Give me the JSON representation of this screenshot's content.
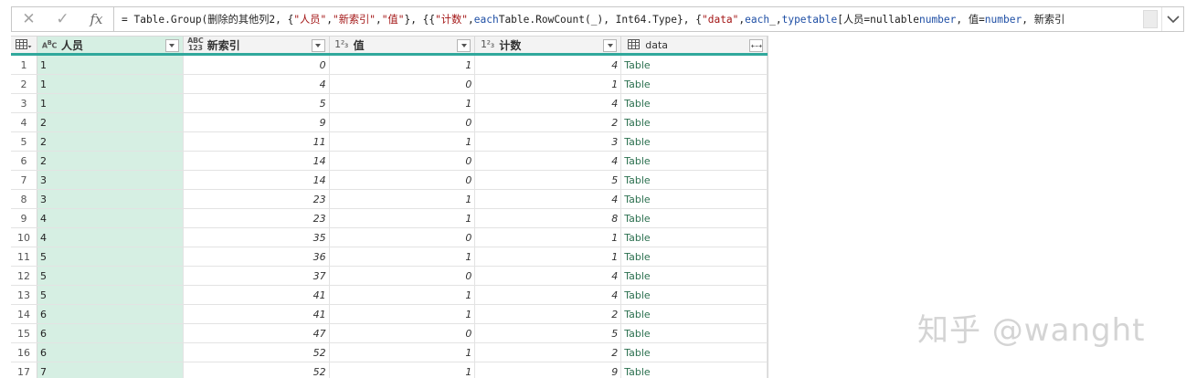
{
  "formula_bar": {
    "cancel_icon": "close-icon",
    "confirm_icon": "check-icon",
    "fx_label": "fx",
    "segments": [
      {
        "t": "= Table.Group(删除的其他列2, {",
        "c": ""
      },
      {
        "t": "\"人员\"",
        "c": "str"
      },
      {
        "t": ", ",
        "c": ""
      },
      {
        "t": "\"新索引\"",
        "c": "str"
      },
      {
        "t": ", ",
        "c": ""
      },
      {
        "t": "\"值\"",
        "c": "str"
      },
      {
        "t": "}, {{",
        "c": ""
      },
      {
        "t": "\"计数\"",
        "c": "str"
      },
      {
        "t": ", ",
        "c": ""
      },
      {
        "t": "each",
        "c": "kw"
      },
      {
        "t": " Table.RowCount(_), Int64.Type}, {",
        "c": ""
      },
      {
        "t": "\"data\"",
        "c": "str"
      },
      {
        "t": ", ",
        "c": ""
      },
      {
        "t": "each",
        "c": "kw"
      },
      {
        "t": " _, ",
        "c": ""
      },
      {
        "t": "type",
        "c": "kw"
      },
      {
        "t": " ",
        "c": ""
      },
      {
        "t": "table",
        "c": "kw"
      },
      {
        "t": " [人员=nullable ",
        "c": ""
      },
      {
        "t": "number",
        "c": "kw"
      },
      {
        "t": ", 值=",
        "c": ""
      },
      {
        "t": "number",
        "c": "kw"
      },
      {
        "t": ", 新索引",
        "c": ""
      }
    ]
  },
  "table": {
    "columns": [
      {
        "name": "人员",
        "type_icon": "ABC"
      },
      {
        "name": "新索引",
        "type_icon": "ABC123"
      },
      {
        "name": "值",
        "type_icon": "123"
      },
      {
        "name": "计数",
        "type_icon": "123"
      },
      {
        "name": "data",
        "type_icon": "table"
      }
    ],
    "rows": [
      [
        "1",
        "1",
        "0",
        "1",
        "4",
        "Table"
      ],
      [
        "2",
        "1",
        "4",
        "0",
        "1",
        "Table"
      ],
      [
        "3",
        "1",
        "5",
        "1",
        "4",
        "Table"
      ],
      [
        "4",
        "2",
        "9",
        "0",
        "2",
        "Table"
      ],
      [
        "5",
        "2",
        "11",
        "1",
        "3",
        "Table"
      ],
      [
        "6",
        "2",
        "14",
        "0",
        "4",
        "Table"
      ],
      [
        "7",
        "3",
        "14",
        "0",
        "5",
        "Table"
      ],
      [
        "8",
        "3",
        "23",
        "1",
        "4",
        "Table"
      ],
      [
        "9",
        "4",
        "23",
        "1",
        "8",
        "Table"
      ],
      [
        "10",
        "4",
        "35",
        "0",
        "1",
        "Table"
      ],
      [
        "11",
        "5",
        "36",
        "1",
        "1",
        "Table"
      ],
      [
        "12",
        "5",
        "37",
        "0",
        "4",
        "Table"
      ],
      [
        "13",
        "5",
        "41",
        "1",
        "4",
        "Table"
      ],
      [
        "14",
        "6",
        "41",
        "1",
        "2",
        "Table"
      ],
      [
        "15",
        "6",
        "47",
        "0",
        "5",
        "Table"
      ],
      [
        "16",
        "6",
        "52",
        "1",
        "2",
        "Table"
      ],
      [
        "17",
        "7",
        "52",
        "1",
        "9",
        "Table"
      ]
    ]
  },
  "watermark": "知乎 @wanght",
  "colors": {
    "selected_column": "#d6efe3",
    "header_underline": "#30a89c",
    "table_link": "#2a6f4e"
  }
}
